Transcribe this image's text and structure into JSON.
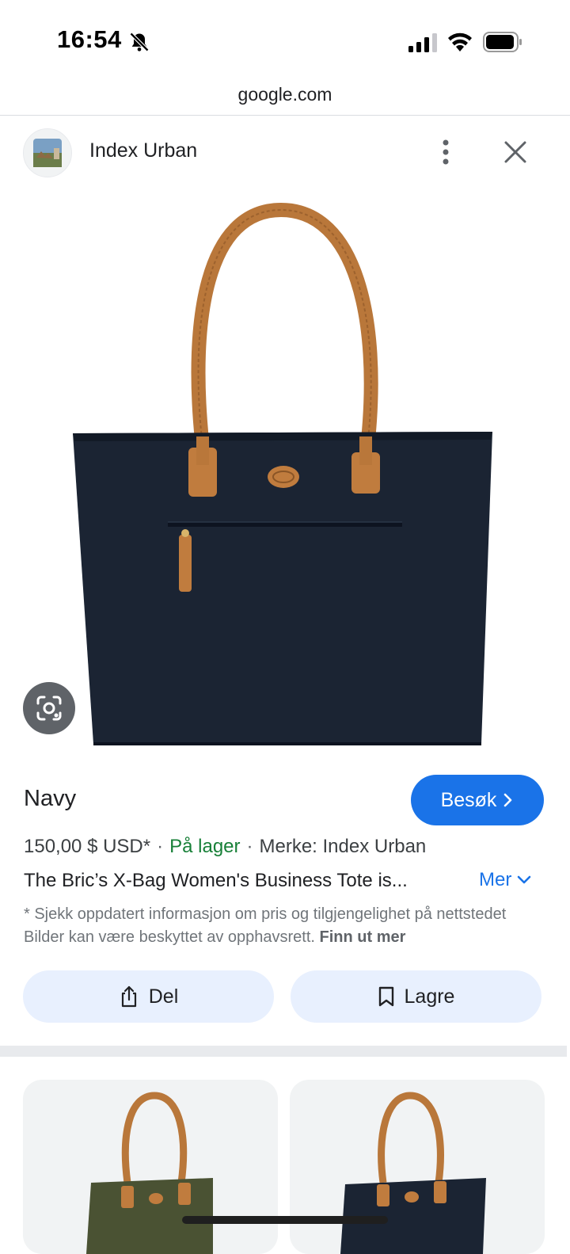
{
  "status_bar": {
    "time": "16:54"
  },
  "browser": {
    "url": "google.com"
  },
  "header": {
    "site_name": "Index Urban"
  },
  "product": {
    "title": "Navy",
    "visit_label": "Besøk",
    "price": "150,00 $ USD*",
    "stock": "På lager",
    "brand": "Merke: Index Urban",
    "description": "The Bric’s X-Bag Women's Business Tote is...",
    "more_label": "Mer",
    "note": "* Sjekk oppdatert informasjon om pris og tilgjengelighet på nettstedet Bilder kan være beskyttet av opphavsrett.",
    "learn_more": "Finn ut mer"
  },
  "actions": {
    "share_label": "Del",
    "save_label": "Lagre"
  },
  "colors": {
    "accent": "#1a73e8",
    "stock": "#188038",
    "button_bg": "#e8f0fe",
    "bag_body": "#1b2433",
    "strap": "#b9773a"
  },
  "icons": [
    "bell-slash-icon",
    "signal-icon",
    "wifi-icon",
    "battery-icon",
    "more-vert-icon",
    "close-icon",
    "lens-icon",
    "chevron-right-icon",
    "chevron-down-icon",
    "share-icon",
    "bookmark-icon"
  ]
}
